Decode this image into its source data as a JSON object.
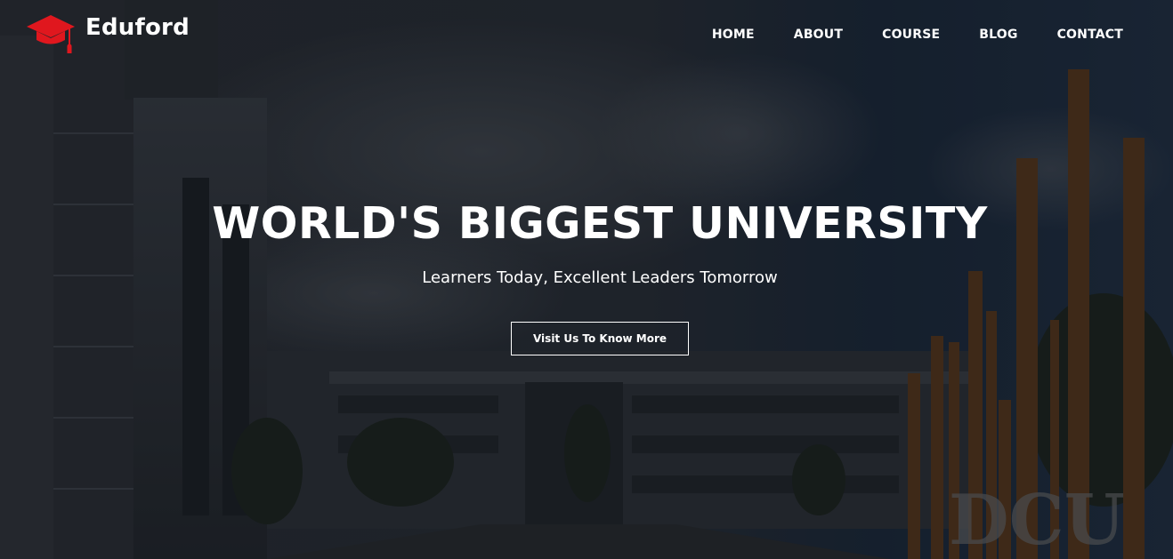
{
  "brand": {
    "name": "Eduford",
    "icon": "graduation-cap-icon",
    "accent_color": "#e0171e"
  },
  "nav": {
    "items": [
      {
        "label": "HOME"
      },
      {
        "label": "ABOUT"
      },
      {
        "label": "COURSE"
      },
      {
        "label": "BLOG"
      },
      {
        "label": "CONTACT"
      }
    ]
  },
  "hero": {
    "title": "WORLD'S BIGGEST UNIVERSITY",
    "subtitle": "Learners Today, Excellent Leaders Tomorrow",
    "cta_label": "Visit Us To Know More",
    "background": "university-campus-photo",
    "sign_text": "DCU"
  }
}
